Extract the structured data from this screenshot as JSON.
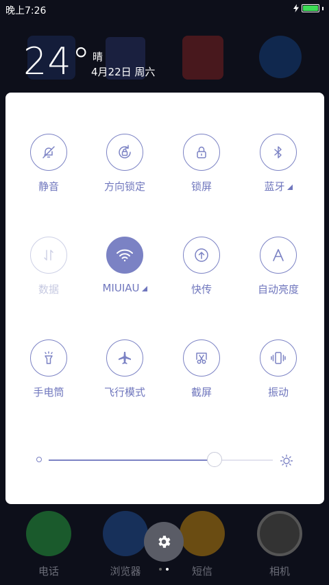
{
  "status_bar": {
    "time": "晚上7:26",
    "battery_level": 1.0
  },
  "weather": {
    "temperature": "24°",
    "condition": "晴",
    "date": "4月22日 周六"
  },
  "quick_settings": [
    {
      "label": "静音",
      "icon": "bell-off-icon",
      "state": "off"
    },
    {
      "label": "方向锁定",
      "icon": "rotation-lock-icon",
      "state": "off"
    },
    {
      "label": "锁屏",
      "icon": "lock-icon",
      "state": "off"
    },
    {
      "label": "蓝牙",
      "icon": "bluetooth-icon",
      "state": "off",
      "has_menu": true
    },
    {
      "label": "数据",
      "icon": "data-arrows-icon",
      "state": "disabled"
    },
    {
      "label": "MIUIAU",
      "icon": "wifi-icon",
      "state": "on",
      "has_menu": true
    },
    {
      "label": "快传",
      "icon": "upload-icon",
      "state": "off"
    },
    {
      "label": "自动亮度",
      "icon": "auto-brightness-icon",
      "state": "off"
    },
    {
      "label": "手电筒",
      "icon": "flashlight-icon",
      "state": "off"
    },
    {
      "label": "飞行模式",
      "icon": "airplane-icon",
      "state": "off"
    },
    {
      "label": "截屏",
      "icon": "screenshot-scissors-icon",
      "state": "off"
    },
    {
      "label": "振动",
      "icon": "vibrate-icon",
      "state": "off"
    }
  ],
  "brightness": {
    "level": 0.74
  },
  "dock": [
    {
      "label": "电话",
      "icon": "phone-icon"
    },
    {
      "label": "浏览器",
      "icon": "browser-icon"
    },
    {
      "label": "短信",
      "icon": "messages-icon"
    },
    {
      "label": "相机",
      "icon": "camera-icon"
    }
  ],
  "settings_button": {
    "icon": "gear-icon"
  },
  "colors": {
    "accent": "#7b82c4",
    "panel": "#ffffff",
    "disabled": "#cdd0e6"
  }
}
